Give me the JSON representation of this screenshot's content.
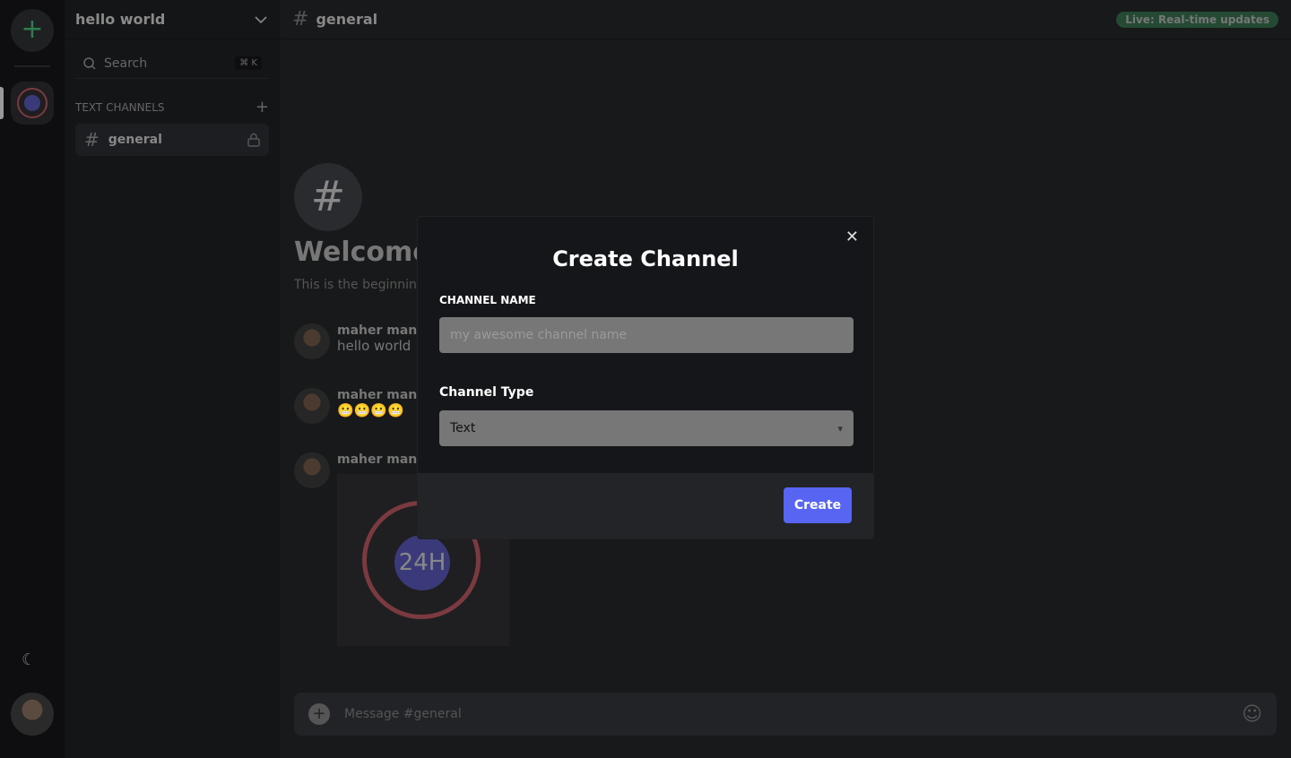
{
  "server": {
    "name": "hello world"
  },
  "search": {
    "label": "Search",
    "shortcut": "⌘ K"
  },
  "sidebar": {
    "section": "TEXT CHANNELS",
    "channels": [
      {
        "name": "general"
      }
    ]
  },
  "header": {
    "channel": "general",
    "live_badge": "Live: Real-time updates"
  },
  "welcome": {
    "title": "Welcome to #general",
    "subtitle": "This is the beginning of the #general channel."
  },
  "messages": [
    {
      "author": "maher mansour",
      "text": "hello world"
    },
    {
      "author": "maher mansour",
      "text": "😬😬😬😬"
    },
    {
      "author": "maher mansour",
      "image_text": "24H"
    }
  ],
  "composer": {
    "placeholder": "Message #general"
  },
  "modal": {
    "title": "Create Channel",
    "name_label": "CHANNEL NAME",
    "name_placeholder": "my awesome channel name",
    "name_value": "",
    "type_label": "Channel Type",
    "type_value": "Text",
    "create": "Create"
  },
  "colors": {
    "accent": "#5865f2",
    "live": "#244a33"
  }
}
